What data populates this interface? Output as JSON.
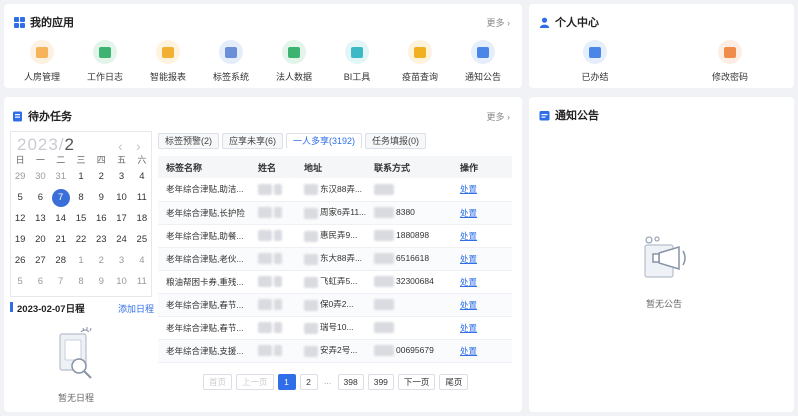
{
  "apps": {
    "title": "我的应用",
    "more": "更多",
    "items": [
      {
        "label": "人房管理",
        "icon": "person-house-icon",
        "color": "#f5b35a",
        "bg": "#fdf1e2"
      },
      {
        "label": "工作日志",
        "icon": "house-icon",
        "color": "#3cb371",
        "bg": "#e3f5ea"
      },
      {
        "label": "智能报表",
        "icon": "report-icon",
        "color": "#f2b035",
        "bg": "#fdf3df"
      },
      {
        "label": "标签系统",
        "icon": "tag-icon",
        "color": "#6a8fd8",
        "bg": "#e6edfa"
      },
      {
        "label": "法人数据",
        "icon": "database-icon",
        "color": "#3cb371",
        "bg": "#e3f5ea"
      },
      {
        "label": "BI工具",
        "icon": "bi-icon",
        "color": "#3db8c6",
        "bg": "#e2f5f7"
      },
      {
        "label": "疫苗查询",
        "icon": "vaccine-icon",
        "color": "#f0b020",
        "bg": "#fdf3dc"
      },
      {
        "label": "通知公告",
        "icon": "chart-icon",
        "color": "#4a86e8",
        "bg": "#e5eefc"
      }
    ]
  },
  "personal": {
    "title": "个人中心",
    "items": [
      {
        "label": "已办结",
        "icon": "done-doc-icon",
        "color": "#4a86e8",
        "bg": "#e5eefc"
      },
      {
        "label": "修改密码",
        "icon": "lock-icon",
        "color": "#f08c4a",
        "bg": "#fdeee3"
      }
    ]
  },
  "tasks": {
    "title": "待办任务",
    "more": "更多",
    "calendar": {
      "year": "2023/",
      "month": "2",
      "weekdays": [
        "日",
        "一",
        "二",
        "三",
        "四",
        "五",
        "六"
      ],
      "weeks": [
        [
          "29",
          "30",
          "31",
          "1",
          "2",
          "3",
          "4"
        ],
        [
          "5",
          "6",
          "7",
          "8",
          "9",
          "10",
          "11"
        ],
        [
          "12",
          "13",
          "14",
          "15",
          "16",
          "17",
          "18"
        ],
        [
          "19",
          "20",
          "21",
          "22",
          "23",
          "24",
          "25"
        ],
        [
          "26",
          "27",
          "28",
          "1",
          "2",
          "3",
          "4"
        ],
        [
          "5",
          "6",
          "7",
          "8",
          "9",
          "10",
          "11"
        ]
      ],
      "selected": "7"
    },
    "schedule": {
      "date": "2023-02-07日程",
      "add": "添加日程",
      "empty": "暂无日程"
    },
    "tabs": [
      "标签预警(2)",
      "应享未享(6)",
      "一人多享(3192)",
      "任务填报(0)"
    ],
    "active_tab": 2,
    "columns": [
      "标签名称",
      "姓名",
      "地址",
      "联系方式",
      "操作"
    ],
    "rows": [
      {
        "tag": "老年综合津贴,助洁...",
        "name": "",
        "addr": "东汉88弄...",
        "phone": "",
        "op": "处置"
      },
      {
        "tag": "老年综合津贴,长护险",
        "name": "",
        "addr": "周家6弄11...",
        "phone": "8380",
        "op": "处置"
      },
      {
        "tag": "老年综合津贴,助餐...",
        "name": "",
        "addr": "惠民弄9...",
        "phone": "1880898",
        "op": "处置"
      },
      {
        "tag": "老年综合津贴,老伙...",
        "name": "",
        "addr": "东大88弄...",
        "phone": "6516618",
        "op": "处置"
      },
      {
        "tag": "粮油帮困卡券,重残...",
        "name": "",
        "addr": "飞虹弄5...",
        "phone": "32300684",
        "op": "处置"
      },
      {
        "tag": "老年综合津贴,春节...",
        "name": "",
        "addr": "保0弄2...",
        "phone": "",
        "op": "处置"
      },
      {
        "tag": "老年综合津贴,春节...",
        "name": "",
        "addr": "瑞号10...",
        "phone": "",
        "op": "处置"
      },
      {
        "tag": "老年综合津贴,支援...",
        "name": "",
        "addr": "安弄2号...",
        "phone": "00695679",
        "op": "处置"
      }
    ],
    "pager": {
      "prev_end": "首页",
      "prev": "上一页",
      "pages": [
        "1",
        "2"
      ],
      "dots": "...",
      "tail": [
        "398",
        "399"
      ],
      "next": "下一页",
      "last": "尾页",
      "current": "1"
    }
  },
  "notice": {
    "title": "通知公告",
    "empty": "暂无公告"
  }
}
